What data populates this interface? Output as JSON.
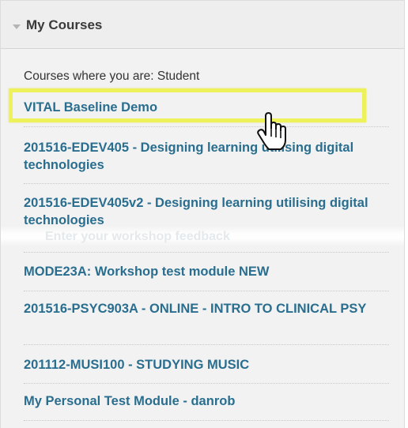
{
  "module": {
    "title": "My Courses",
    "section_label": "Courses where you are: Student"
  },
  "courses": [
    {
      "label": "VITAL Baseline Demo"
    },
    {
      "label": "201516-EDEV405 - Designing learning utilising digital technologies"
    },
    {
      "label": "201516-EDEV405v2 - Designing learning utilising digital technologies"
    },
    {
      "label": "MODE23A: Workshop test module NEW"
    },
    {
      "label": "201516-PSYC903A - ONLINE - INTRO TO CLINICAL PSY"
    },
    {
      "label": "201112-MUSI100 - STUDYING MUSIC"
    },
    {
      "label": "My Personal Test Module - danrob"
    }
  ],
  "overlay": {
    "ghost_text": "Enter your workshop feedback"
  },
  "colors": {
    "link": "#2a6e8f",
    "highlight": "#eef25a",
    "panel_bg": "#f2f2f2"
  },
  "icons": {
    "collapse": "triangle-down-icon",
    "cursor": "hand-pointer-icon"
  }
}
